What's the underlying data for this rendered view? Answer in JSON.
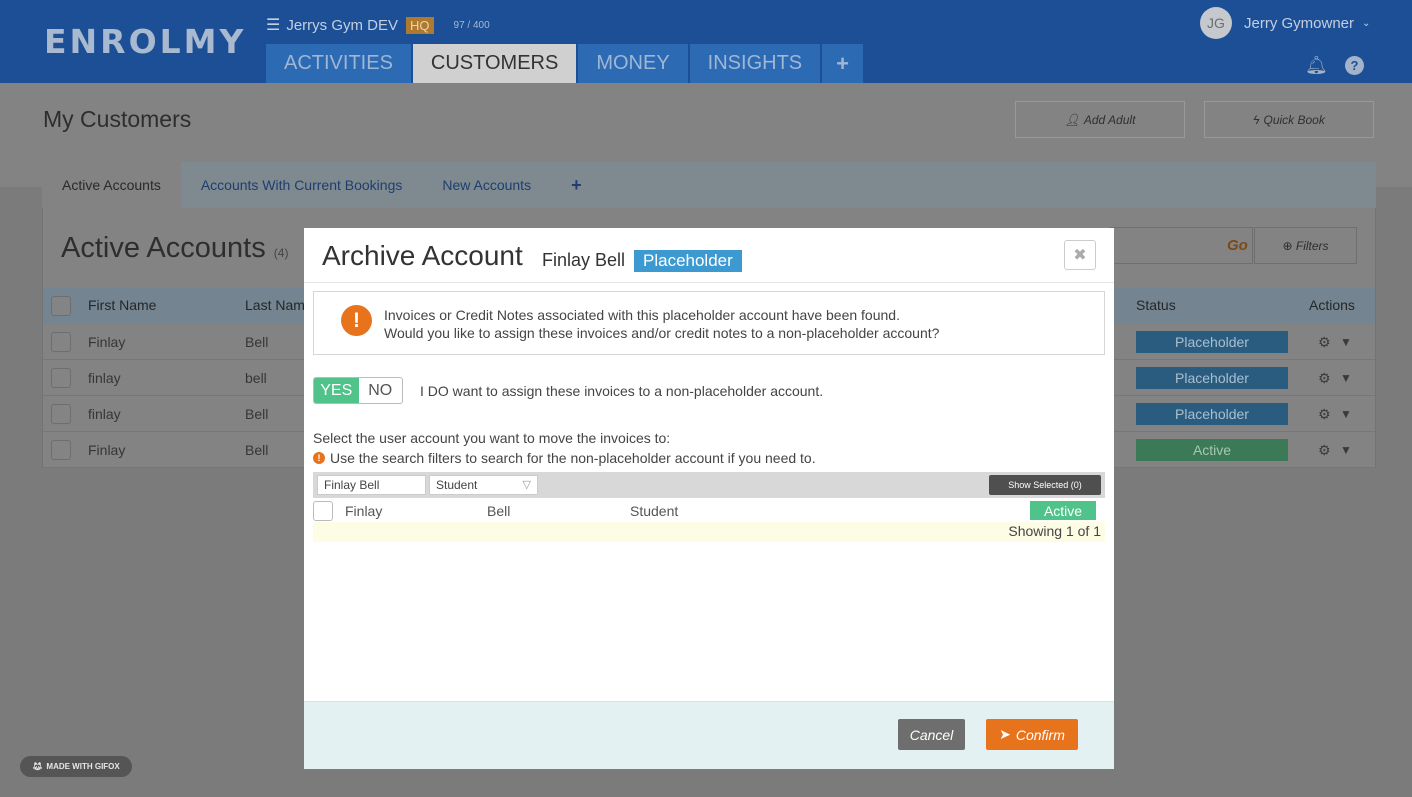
{
  "header": {
    "logo": "ENROLMY",
    "org_name": "Jerrys Gym DEV",
    "org_badge": "HQ",
    "org_count": "97 / 400",
    "user_initials": "JG",
    "user_name": "Jerry Gymowner",
    "tabs": [
      {
        "label": "ACTIVITIES"
      },
      {
        "label": "CUSTOMERS"
      },
      {
        "label": "MONEY"
      },
      {
        "label": "INSIGHTS"
      },
      {
        "label": "+"
      }
    ],
    "active_tab": "CUSTOMERS"
  },
  "page": {
    "title": "My Customers",
    "add_adult": "Add Adult",
    "quick_book": "Quick Book",
    "subtabs": [
      {
        "label": "Active Accounts"
      },
      {
        "label": "Accounts With Current Bookings"
      },
      {
        "label": "New Accounts"
      },
      {
        "label": "+"
      }
    ],
    "section_title": "Active Accounts",
    "section_count": "(4)",
    "go_label": "Go",
    "filters_label": "Filters",
    "columns": {
      "first": "First Name",
      "last": "Last Nam",
      "status": "Status",
      "actions": "Actions"
    },
    "rows": [
      {
        "first": "Finlay",
        "last": "Bell",
        "status": "Placeholder"
      },
      {
        "first": "finlay",
        "last": "bell",
        "status": "Placeholder"
      },
      {
        "first": "finlay",
        "last": "Bell",
        "status": "Placeholder"
      },
      {
        "first": "Finlay",
        "last": "Bell",
        "status": "Active"
      }
    ]
  },
  "modal": {
    "title": "Archive Account",
    "account_name": "Finlay Bell",
    "account_badge": "Placeholder",
    "alert_line1": "Invoices or Credit Notes associated with this placeholder account have been found.",
    "alert_line2": "Would you like to assign these invoices and/or credit notes to a non-placeholder account?",
    "toggle_yes": "YES",
    "toggle_no": "NO",
    "toggle_label": "I DO want to assign these invoices to a non-placeholder account.",
    "select_label": "Select the user account you want to move the invoices to:",
    "hint": "Use the search filters to search for the non-placeholder account if you need to.",
    "search_value": "Finlay Bell",
    "type_select": "Student",
    "show_selected": "Show Selected (0)",
    "result": {
      "first": "Finlay",
      "last": "Bell",
      "type": "Student",
      "status": "Active"
    },
    "showing": "Showing 1 of 1",
    "cancel": "Cancel",
    "confirm": "Confirm"
  },
  "watermark": "MADE WITH GIFOX",
  "colors": {
    "header_blue": "#1c4f96",
    "tab_blue": "#2c6ab4",
    "placeholder_blue": "#3d9ad1",
    "active_green": "#4fc38a",
    "confirm_orange": "#e8731d"
  }
}
